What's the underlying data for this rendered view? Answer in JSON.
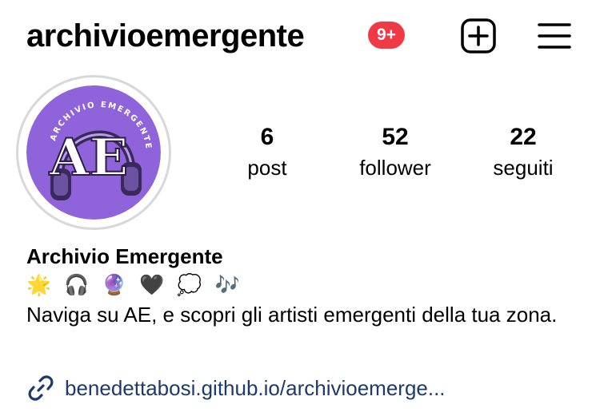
{
  "header": {
    "username": "archivioemergente",
    "notification_count": "9+"
  },
  "avatar": {
    "monogram": "AE",
    "ring_text": "ARCHIVIO EMERGENTE",
    "background_color": "#8f63d9"
  },
  "stats": [
    {
      "value": "6",
      "label": "post"
    },
    {
      "value": "52",
      "label": "follower"
    },
    {
      "value": "22",
      "label": "seguiti"
    }
  ],
  "profile": {
    "display_name": "Archivio Emergente",
    "emojis": [
      "🌟",
      "🎧",
      "🔮",
      "🖤",
      "💭",
      "🎶"
    ],
    "bio": "Naviga su AE, e scopri gli artisti emergenti della tua zona.",
    "link": "benedettabosi.github.io/archivioemerge..."
  },
  "colors": {
    "badge": "#ef3a46",
    "link": "#1d3a6b"
  },
  "icons": {
    "new_post": "plus-square-icon",
    "menu": "hamburger-menu-icon",
    "link": "link-icon"
  }
}
